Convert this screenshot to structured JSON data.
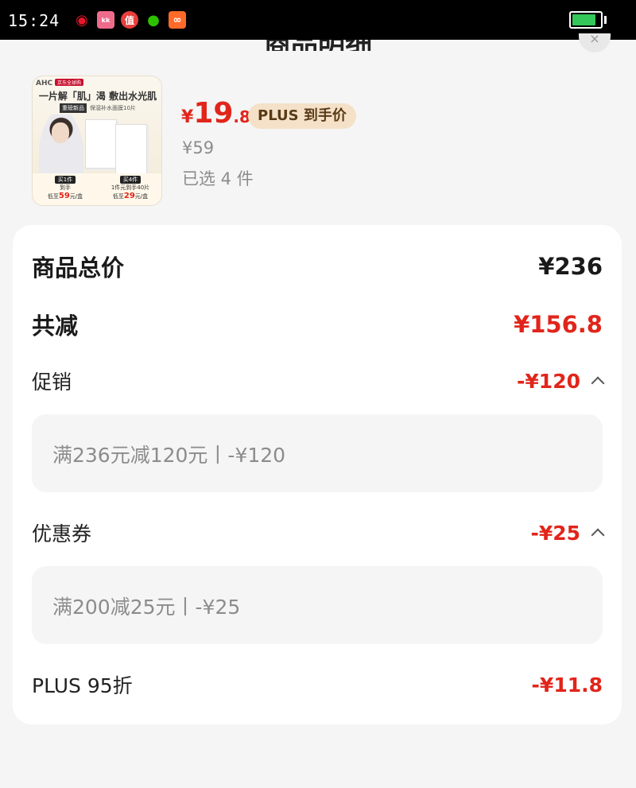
{
  "status_bar": {
    "time": "15:24",
    "apps": [
      "weibo-icon",
      "kuaishou-icon",
      "smzdm-icon",
      "wechat-icon",
      "app-icon"
    ],
    "battery_level": 0.85
  },
  "sheet": {
    "title": "商品明细",
    "close_glyph": "×"
  },
  "product": {
    "thumb": {
      "brand": "AHC",
      "tag": "京东全球购",
      "headline": "一片解「肌」渴 敷出水光肌",
      "sub": "重磅新品",
      "sub2": "保湿补水面膜10片",
      "left_pill": "买1件",
      "left_line": "到手",
      "left_price": "59",
      "left_unit": "元/盒",
      "right_pill": "买4件",
      "right_line": "1件元到手40片",
      "right_price": "29",
      "right_unit": "元/盒",
      "low_label": "低至"
    },
    "price_symbol": "¥",
    "price_int": "19",
    "price_dec": ".8",
    "plus_label": "PLUS 到手价",
    "original_price": "¥59",
    "selected": "已选 4 件"
  },
  "summary": {
    "total_label": "商品总价",
    "total_value": "¥236",
    "reduce_label": "共减",
    "reduce_value": "¥156.8",
    "promo_label": "促销",
    "promo_value": "-¥120",
    "promo_detail": "满236元减120元丨-¥120",
    "coupon_label": "优惠券",
    "coupon_value": "-¥25",
    "coupon_detail": "满200减25元丨-¥25",
    "plus_label": "PLUS 95折",
    "plus_value": "-¥11.8"
  }
}
